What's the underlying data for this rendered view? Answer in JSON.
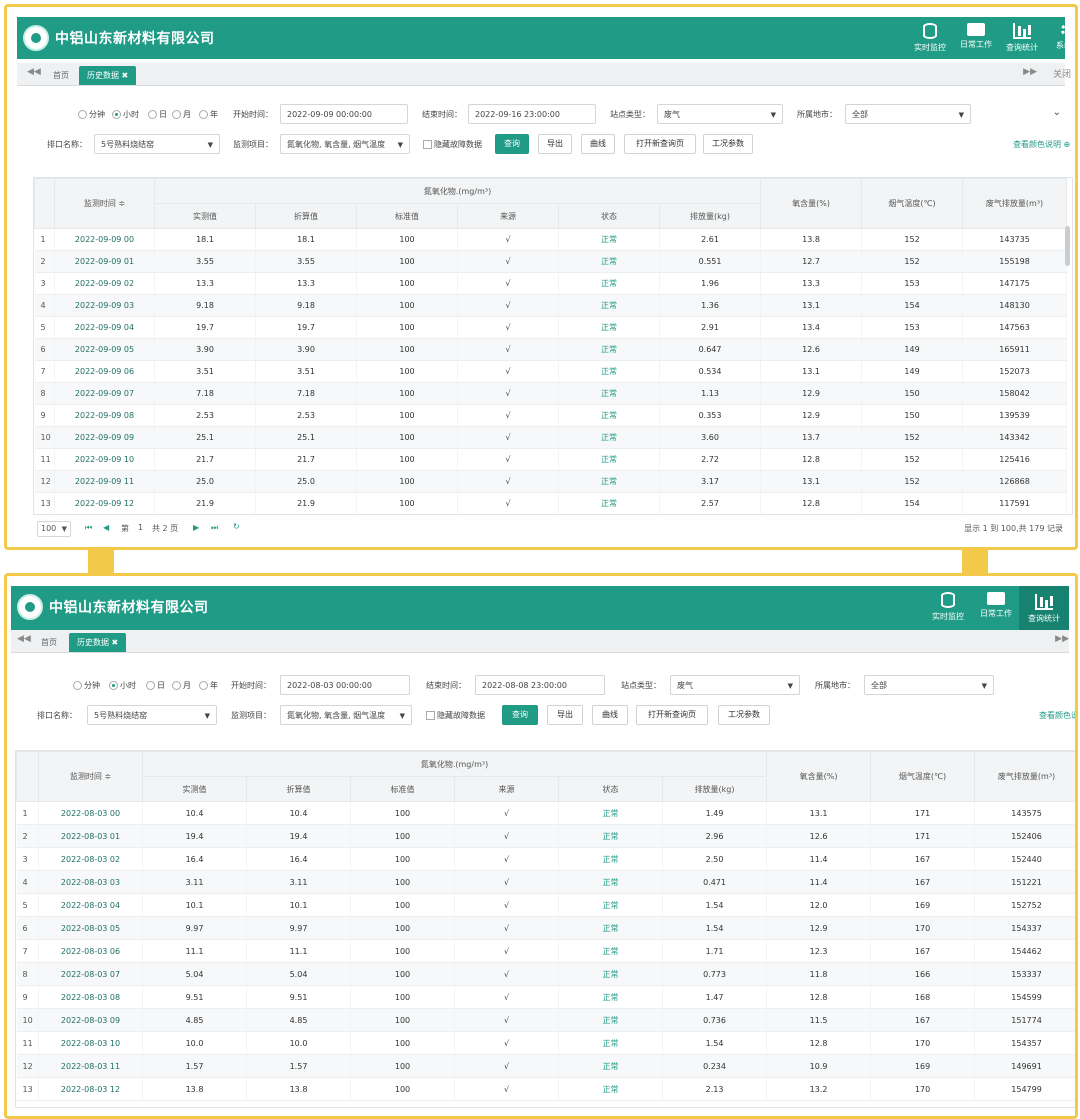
{
  "app": {
    "company": "中铝山东新材料有限公司",
    "nav": [
      {
        "label": "实时监控",
        "icon": "database-icon"
      },
      {
        "label": "日常工作",
        "icon": "briefcase-icon"
      },
      {
        "label": "查询统计",
        "icon": "bar-chart-icon"
      },
      {
        "label": "系统管",
        "icon": "gear-icon"
      }
    ],
    "tabs": {
      "home": "首页",
      "history": "历史数据",
      "close_right": "关闭"
    },
    "filters": {
      "periods": [
        "分钟",
        "小时",
        "日",
        "月",
        "年"
      ],
      "selected_period": "小时",
      "start_label": "开始时间：",
      "end_label": "结束时间：",
      "site_type_label": "站点类型：",
      "site_type_value": "废气",
      "city_label": "所属地市：",
      "city_value": "全部",
      "outlet_label": "排口名称：",
      "outlet_value": "5号熟料烧结窑",
      "item_label": "监测项目：",
      "item_value": "氮氧化物, 氧含量, 烟气温度",
      "hide_fault_label": "隐藏故障数据",
      "buttons": {
        "query": "查询",
        "export": "导出",
        "curve": "曲线",
        "open_new": "打开新查询页",
        "params": "工况参数"
      },
      "color_legend": "查看颜色说明"
    },
    "table_headers": {
      "time": "监测时间 ≑",
      "group": "氮氧化物.(mg/m³)",
      "measured": "实测值",
      "converted": "折算值",
      "standard": "标准值",
      "source": "来源",
      "status": "状态",
      "emission": "排放量(kg)",
      "oxygen": "氧含量(%)",
      "temp": "烟气温度(℃)",
      "flow": "废气排放量(m³)"
    }
  },
  "panel_top": {
    "start_time": "2022-09-09 00:00:00",
    "end_time": "2022-09-16 23:00:00",
    "rows": [
      [
        "1",
        "2022-09-09 00",
        "18.1",
        "18.1",
        "100",
        "√",
        "正常",
        "2.61",
        "13.8",
        "152",
        "143735"
      ],
      [
        "2",
        "2022-09-09 01",
        "3.55",
        "3.55",
        "100",
        "√",
        "正常",
        "0.551",
        "12.7",
        "152",
        "155198"
      ],
      [
        "3",
        "2022-09-09 02",
        "13.3",
        "13.3",
        "100",
        "√",
        "正常",
        "1.96",
        "13.3",
        "153",
        "147175"
      ],
      [
        "4",
        "2022-09-09 03",
        "9.18",
        "9.18",
        "100",
        "√",
        "正常",
        "1.36",
        "13.1",
        "154",
        "148130"
      ],
      [
        "5",
        "2022-09-09 04",
        "19.7",
        "19.7",
        "100",
        "√",
        "正常",
        "2.91",
        "13.4",
        "153",
        "147563"
      ],
      [
        "6",
        "2022-09-09 05",
        "3.90",
        "3.90",
        "100",
        "√",
        "正常",
        "0.647",
        "12.6",
        "149",
        "165911"
      ],
      [
        "7",
        "2022-09-09 06",
        "3.51",
        "3.51",
        "100",
        "√",
        "正常",
        "0.534",
        "13.1",
        "149",
        "152073"
      ],
      [
        "8",
        "2022-09-09 07",
        "7.18",
        "7.18",
        "100",
        "√",
        "正常",
        "1.13",
        "12.9",
        "150",
        "158042"
      ],
      [
        "9",
        "2022-09-09 08",
        "2.53",
        "2.53",
        "100",
        "√",
        "正常",
        "0.353",
        "12.9",
        "150",
        "139539"
      ],
      [
        "10",
        "2022-09-09 09",
        "25.1",
        "25.1",
        "100",
        "√",
        "正常",
        "3.60",
        "13.7",
        "152",
        "143342"
      ],
      [
        "11",
        "2022-09-09 10",
        "21.7",
        "21.7",
        "100",
        "√",
        "正常",
        "2.72",
        "12.8",
        "152",
        "125416"
      ],
      [
        "12",
        "2022-09-09 11",
        "25.0",
        "25.0",
        "100",
        "√",
        "正常",
        "3.17",
        "13.1",
        "152",
        "126868"
      ],
      [
        "13",
        "2022-09-09 12",
        "21.9",
        "21.9",
        "100",
        "√",
        "正常",
        "2.57",
        "12.8",
        "154",
        "117591"
      ]
    ],
    "pager": {
      "page_size": "100",
      "page_prefix": "第",
      "page_num": "1",
      "page_total": "共 2 页",
      "summary": "显示 1 到 100,共 179 记录"
    }
  },
  "panel_bottom": {
    "start_time": "2022-08-03 00:00:00",
    "end_time": "2022-08-08 23:00:00",
    "rows": [
      [
        "1",
        "2022-08-03 00",
        "10.4",
        "10.4",
        "100",
        "√",
        "正常",
        "1.49",
        "13.1",
        "171",
        "143575"
      ],
      [
        "2",
        "2022-08-03 01",
        "19.4",
        "19.4",
        "100",
        "√",
        "正常",
        "2.96",
        "12.6",
        "171",
        "152406"
      ],
      [
        "3",
        "2022-08-03 02",
        "16.4",
        "16.4",
        "100",
        "√",
        "正常",
        "2.50",
        "11.4",
        "167",
        "152440"
      ],
      [
        "4",
        "2022-08-03 03",
        "3.11",
        "3.11",
        "100",
        "√",
        "正常",
        "0.471",
        "11.4",
        "167",
        "151221"
      ],
      [
        "5",
        "2022-08-03 04",
        "10.1",
        "10.1",
        "100",
        "√",
        "正常",
        "1.54",
        "12.0",
        "169",
        "152752"
      ],
      [
        "6",
        "2022-08-03 05",
        "9.97",
        "9.97",
        "100",
        "√",
        "正常",
        "1.54",
        "12.9",
        "170",
        "154337"
      ],
      [
        "7",
        "2022-08-03 06",
        "11.1",
        "11.1",
        "100",
        "√",
        "正常",
        "1.71",
        "12.3",
        "167",
        "154462"
      ],
      [
        "8",
        "2022-08-03 07",
        "5.04",
        "5.04",
        "100",
        "√",
        "正常",
        "0.773",
        "11.8",
        "166",
        "153337"
      ],
      [
        "9",
        "2022-08-03 08",
        "9.51",
        "9.51",
        "100",
        "√",
        "正常",
        "1.47",
        "12.8",
        "168",
        "154599"
      ],
      [
        "10",
        "2022-08-03 09",
        "4.85",
        "4.85",
        "100",
        "√",
        "正常",
        "0.736",
        "11.5",
        "167",
        "151774"
      ],
      [
        "11",
        "2022-08-03 10",
        "10.0",
        "10.0",
        "100",
        "√",
        "正常",
        "1.54",
        "12.8",
        "170",
        "154357"
      ],
      [
        "12",
        "2022-08-03 11",
        "1.57",
        "1.57",
        "100",
        "√",
        "正常",
        "0.234",
        "10.9",
        "169",
        "149691"
      ],
      [
        "13",
        "2022-08-03 12",
        "13.8",
        "13.8",
        "100",
        "√",
        "正常",
        "2.13",
        "13.2",
        "170",
        "154799"
      ]
    ]
  },
  "colors": {
    "brand": "#1f9b86",
    "frame": "#f3c94a"
  }
}
